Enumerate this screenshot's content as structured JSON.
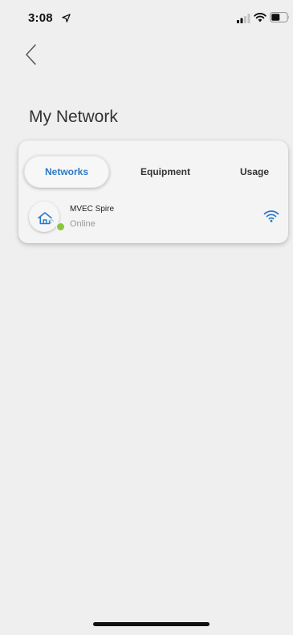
{
  "status_bar": {
    "time": "3:08"
  },
  "header": {
    "title": "My Network"
  },
  "tabs": [
    {
      "label": "Networks",
      "active": true
    },
    {
      "label": "Equipment",
      "active": false
    },
    {
      "label": "Usage",
      "active": false
    }
  ],
  "networks": [
    {
      "name": "MVEC Spire",
      "status": "Online",
      "status_color": "#8bc63f"
    }
  ],
  "colors": {
    "accent": "#2b78c6",
    "online": "#8bc63f",
    "background": "#efefef"
  },
  "icons": {
    "back": "chevron-left-icon",
    "network": "home-wifi-icon",
    "signal": "wifi-icon"
  }
}
